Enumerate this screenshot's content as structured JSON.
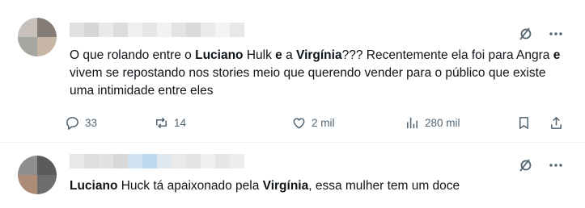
{
  "tweet1": {
    "text_parts": {
      "p1": "O que rolando entre o ",
      "b1": "Luciano",
      "p2": " Hulk ",
      "b2": "e",
      "p3": " a ",
      "b3": "Virgínia",
      "p4": "??? Recentemente ela foi para Angra ",
      "b4": "e",
      "p5": " vivem se repostando nos stories meio que querendo vender para o público que existe uma intimidade entre eles"
    },
    "replies": "33",
    "reposts": "14",
    "likes": "2 mil",
    "views": "280 mil"
  },
  "tweet2": {
    "text_parts": {
      "b1": "Luciano",
      "p1": " Huck tá apaixonado pela ",
      "b2": "Virgínia",
      "p2": ", essa mulher tem um doce"
    }
  },
  "icons": {
    "grok": "grok-icon",
    "more": "more-icon",
    "reply": "reply-icon",
    "repost": "repost-icon",
    "like": "like-icon",
    "views": "views-icon",
    "bookmark": "bookmark-icon",
    "share": "share-icon"
  },
  "colors": {
    "text": "#0f1419",
    "muted": "#536471",
    "divider": "#eff3f4"
  }
}
